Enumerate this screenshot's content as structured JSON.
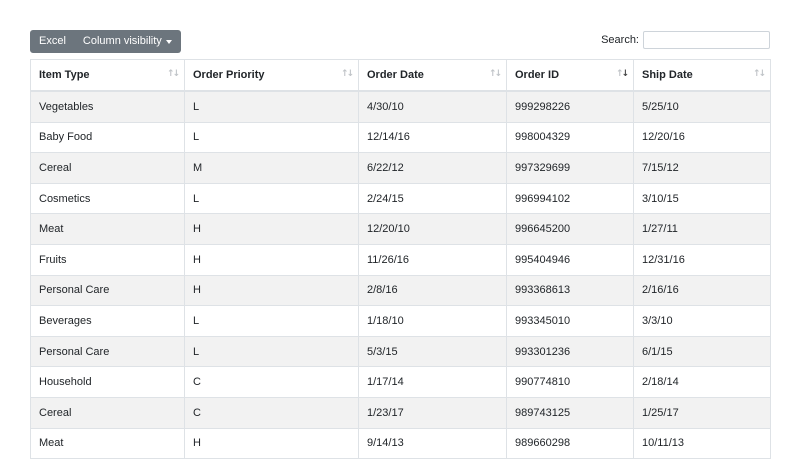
{
  "toolbar": {
    "excel_label": "Excel",
    "column_visibility_label": "Column visibility"
  },
  "search": {
    "label": "Search:",
    "value": ""
  },
  "table": {
    "columns": [
      "Item Type",
      "Order Priority",
      "Order Date",
      "Order ID",
      "Ship Date"
    ],
    "sorted_column": "Order ID",
    "sort_direction": "descending",
    "rows": [
      [
        "Vegetables",
        "L",
        "4/30/10",
        "999298226",
        "5/25/10"
      ],
      [
        "Baby Food",
        "L",
        "12/14/16",
        "998004329",
        "12/20/16"
      ],
      [
        "Cereal",
        "M",
        "6/22/12",
        "997329699",
        "7/15/12"
      ],
      [
        "Cosmetics",
        "L",
        "2/24/15",
        "996994102",
        "3/10/15"
      ],
      [
        "Meat",
        "H",
        "12/20/10",
        "996645200",
        "1/27/11"
      ],
      [
        "Fruits",
        "H",
        "11/26/16",
        "995404946",
        "12/31/16"
      ],
      [
        "Personal Care",
        "H",
        "2/8/16",
        "993368613",
        "2/16/16"
      ],
      [
        "Beverages",
        "L",
        "1/18/10",
        "993345010",
        "3/3/10"
      ],
      [
        "Personal Care",
        "L",
        "5/3/15",
        "993301236",
        "6/1/15"
      ],
      [
        "Household",
        "C",
        "1/17/14",
        "990774810",
        "2/18/14"
      ],
      [
        "Cereal",
        "C",
        "1/23/17",
        "989743125",
        "1/25/17"
      ],
      [
        "Meat",
        "H",
        "9/14/13",
        "989660298",
        "10/11/13"
      ]
    ]
  },
  "colors": {
    "button_bg": "#6c757d",
    "stripe": "#f2f2f2",
    "border": "#dee2e6"
  }
}
